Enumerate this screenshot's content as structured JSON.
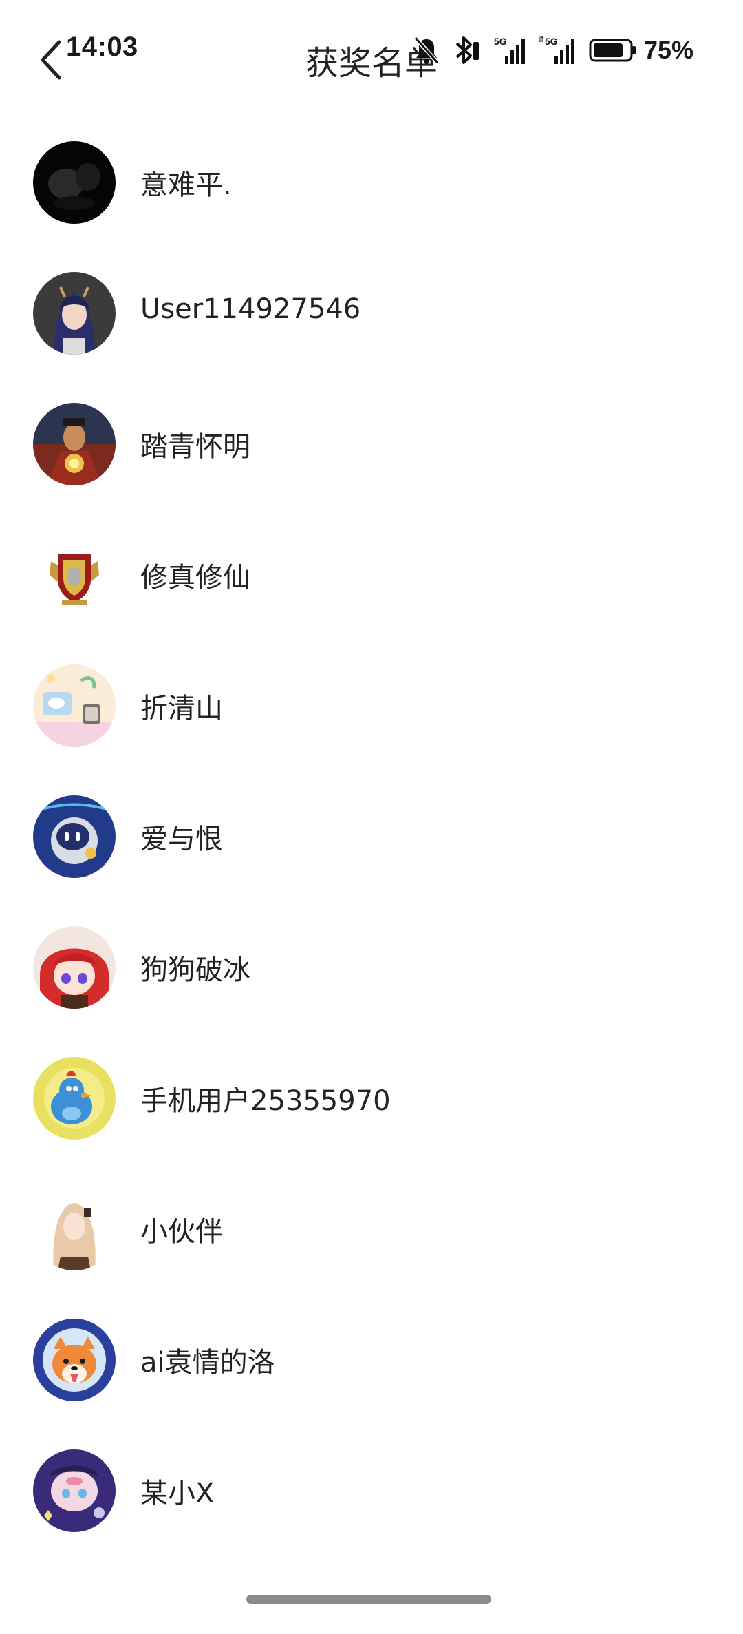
{
  "status_bar": {
    "time": "14:03",
    "battery": "75%",
    "icons": [
      "mute-icon",
      "bluetooth-icon",
      "signal-5g-icon",
      "signal-5g-data-icon",
      "battery-icon"
    ]
  },
  "header": {
    "title": "获奖名单",
    "back_icon": "chevron-left-icon"
  },
  "winners": [
    {
      "name": "意难平."
    },
    {
      "name": "User114927546"
    },
    {
      "name": "踏青怀明"
    },
    {
      "name": "修真修仙"
    },
    {
      "name": "折清山"
    },
    {
      "name": "爱与恨"
    },
    {
      "name": "狗狗破冰"
    },
    {
      "name": "手机用户25355970"
    },
    {
      "name": "小伙伴"
    },
    {
      "name": "ai袁情的洛"
    },
    {
      "name": "某小X"
    }
  ]
}
